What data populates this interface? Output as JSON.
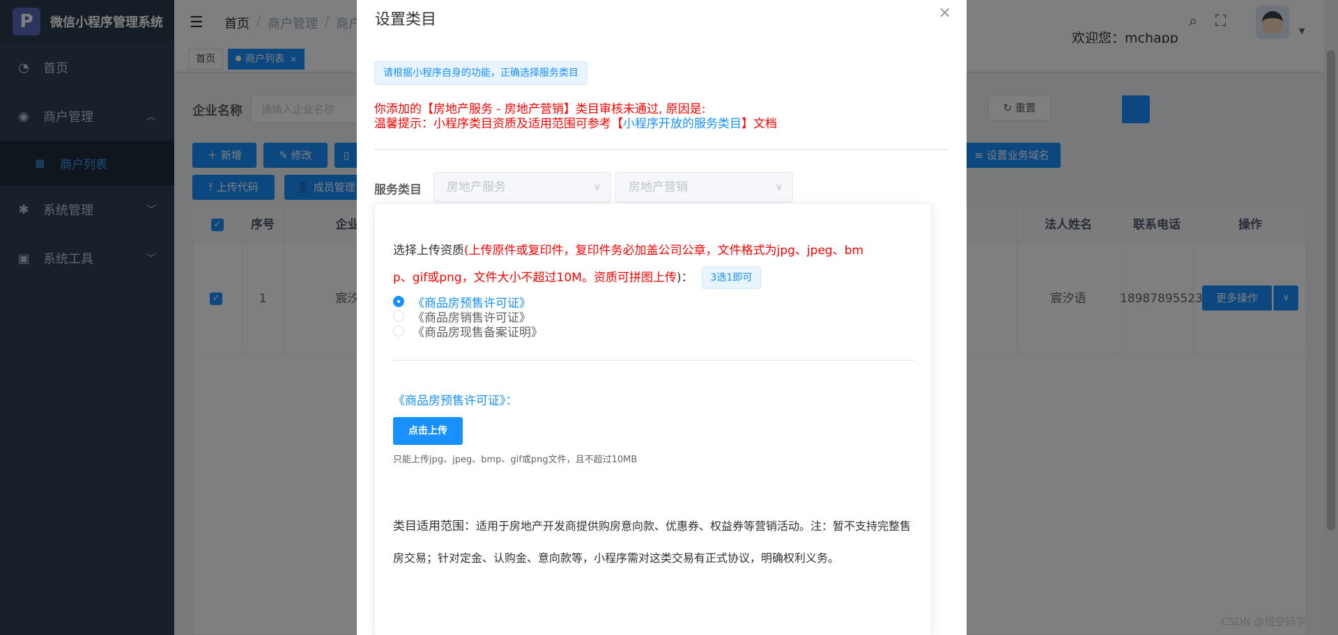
{
  "app": {
    "title": "微信小程序管理系统",
    "logo_letter": "P"
  },
  "sidebar": {
    "items": [
      {
        "label": "首页",
        "icon": "dashboard-icon"
      },
      {
        "label": "商户管理",
        "icon": "merchant-icon",
        "arrow": "︿"
      },
      {
        "label": "商户列表",
        "icon": "table-icon"
      },
      {
        "label": "系统管理",
        "icon": "gear-icon",
        "arrow": "﹀"
      },
      {
        "label": "系统工具",
        "icon": "toolbox-icon",
        "arrow": "﹀"
      }
    ]
  },
  "header": {
    "breadcrumb": [
      "首页",
      "商户管理",
      "商户"
    ],
    "welcome": "欢迎您：mchapp"
  },
  "tags": {
    "home": "首页",
    "active": "商户列表",
    "close": "×"
  },
  "filter": {
    "label": "企业名称",
    "placeholder": "请输入企业名称",
    "reset": "重置"
  },
  "toolbar": {
    "add": "新增",
    "edit": "修改",
    "upload_code": "上传代码",
    "members": "成员管理",
    "set_domain": "设置业务域名"
  },
  "table": {
    "headers": {
      "index": "序号",
      "company": "企业名",
      "legal_name": "法人姓名",
      "phone": "联系电话",
      "actions": "操作"
    },
    "rows": [
      {
        "index": "1",
        "company": "宸汐语",
        "legal_name": "宸汐语",
        "phone": "18987895523",
        "action": "更多操作"
      }
    ]
  },
  "dialog": {
    "title": "设置类目",
    "close": "×",
    "hint": "请根据小程序自身的功能，正确选择服务类目",
    "reject_line": "你添加的【房地产服务 - 房地产营销】类目审核未通过, 原因是:",
    "tip_prefix": "温馨提示：小程序类目资质及适用范围可参考【",
    "tip_link": "小程序开放的服务类目",
    "tip_suffix": "】文档",
    "service_label": "服务类目",
    "category1": "房地产服务",
    "category2": "房地产营销",
    "upload_title": "选择上传资质",
    "upload_rule_1": "(上传原件或复印件，复印件务必加盖公司公章，文件格式为jpg、jpeg、bm",
    "upload_rule_2": "p、gif或png，文件大小不超过10M。资质可拼图上传",
    "upload_rule_close": ")：",
    "choose_hint": "3选1即可",
    "options": [
      "《商品房预售许可证》",
      "《商品房销售许可证》",
      "《商品房现售备案证明》"
    ],
    "selected_option": 0,
    "cert_title": "《商品房预售许可证》：",
    "upload_button": "点击上传",
    "upload_tip": "只能上传jpg、jpeg、bmp、gif或png文件，且不超过10MB",
    "scope_label": "类目适用范围：",
    "scope_text": "适用于房地产开发商提供购房意向款、优惠券、权益券等营销活动。注：暂不支持完整售房交易；针对定金、认购金、意向款等，小程序需对这类交易有正式协议，明确权利义务。"
  },
  "watermark": "CSDN @悟空码字",
  "colors": {
    "primary": "#1890ff",
    "sidebar": "#304156",
    "danger": "#ff0000"
  }
}
